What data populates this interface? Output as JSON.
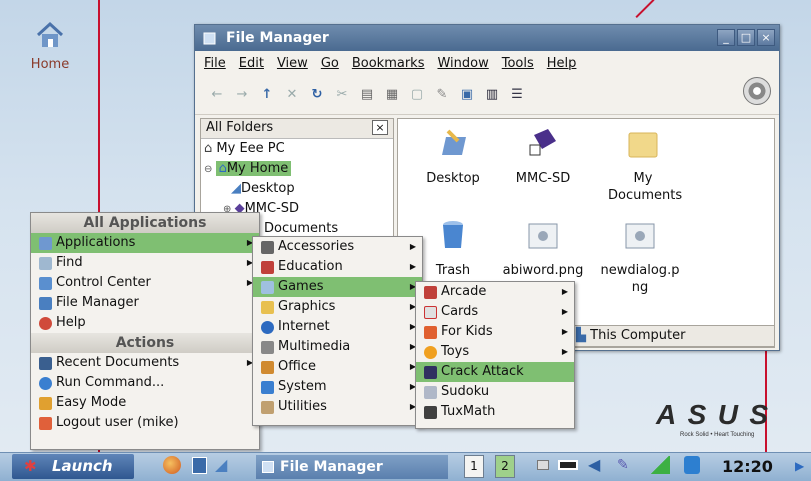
{
  "desktop": {
    "home_label": "Home"
  },
  "file_manager": {
    "title": "File Manager",
    "menu": [
      "File",
      "Edit",
      "View",
      "Go",
      "Bookmarks",
      "Window",
      "Tools",
      "Help"
    ],
    "tree_header": "All Folders",
    "tree": [
      "My Eee PC",
      "My Home",
      "Desktop",
      "MMC-SD",
      "My Documents"
    ],
    "icons": [
      "Desktop",
      "MMC-SD",
      "My Documents",
      "Trash",
      "abiword.png",
      "newdialog.png"
    ],
    "status": "This Computer"
  },
  "start_menu": {
    "header_all": "All Applications",
    "items": [
      "Applications",
      "Find",
      "Control Center",
      "File Manager",
      "Help"
    ],
    "header_actions": "Actions",
    "actions": [
      "Recent Documents",
      "Run Command...",
      "Easy Mode",
      "Logout user (mike)"
    ]
  },
  "applications_menu": [
    "Accessories",
    "Education",
    "Games",
    "Graphics",
    "Internet",
    "Multimedia",
    "Office",
    "System",
    "Utilities"
  ],
  "games_menu": [
    "Arcade",
    "Cards",
    "For Kids",
    "Toys",
    "Crack Attack",
    "Sudoku",
    "TuxMath"
  ],
  "taskbar": {
    "launch": "Launch",
    "task": "File Manager",
    "workspaces": [
      "1",
      "2"
    ],
    "clock": "12:20"
  },
  "logo": {
    "brand": "ASUS",
    "tagline": "Rock Solid • Heart Touching"
  },
  "colors": {
    "selection": "#7fbf72",
    "title_bar": "#4a6a90",
    "annotation_line": "#c8102e"
  }
}
